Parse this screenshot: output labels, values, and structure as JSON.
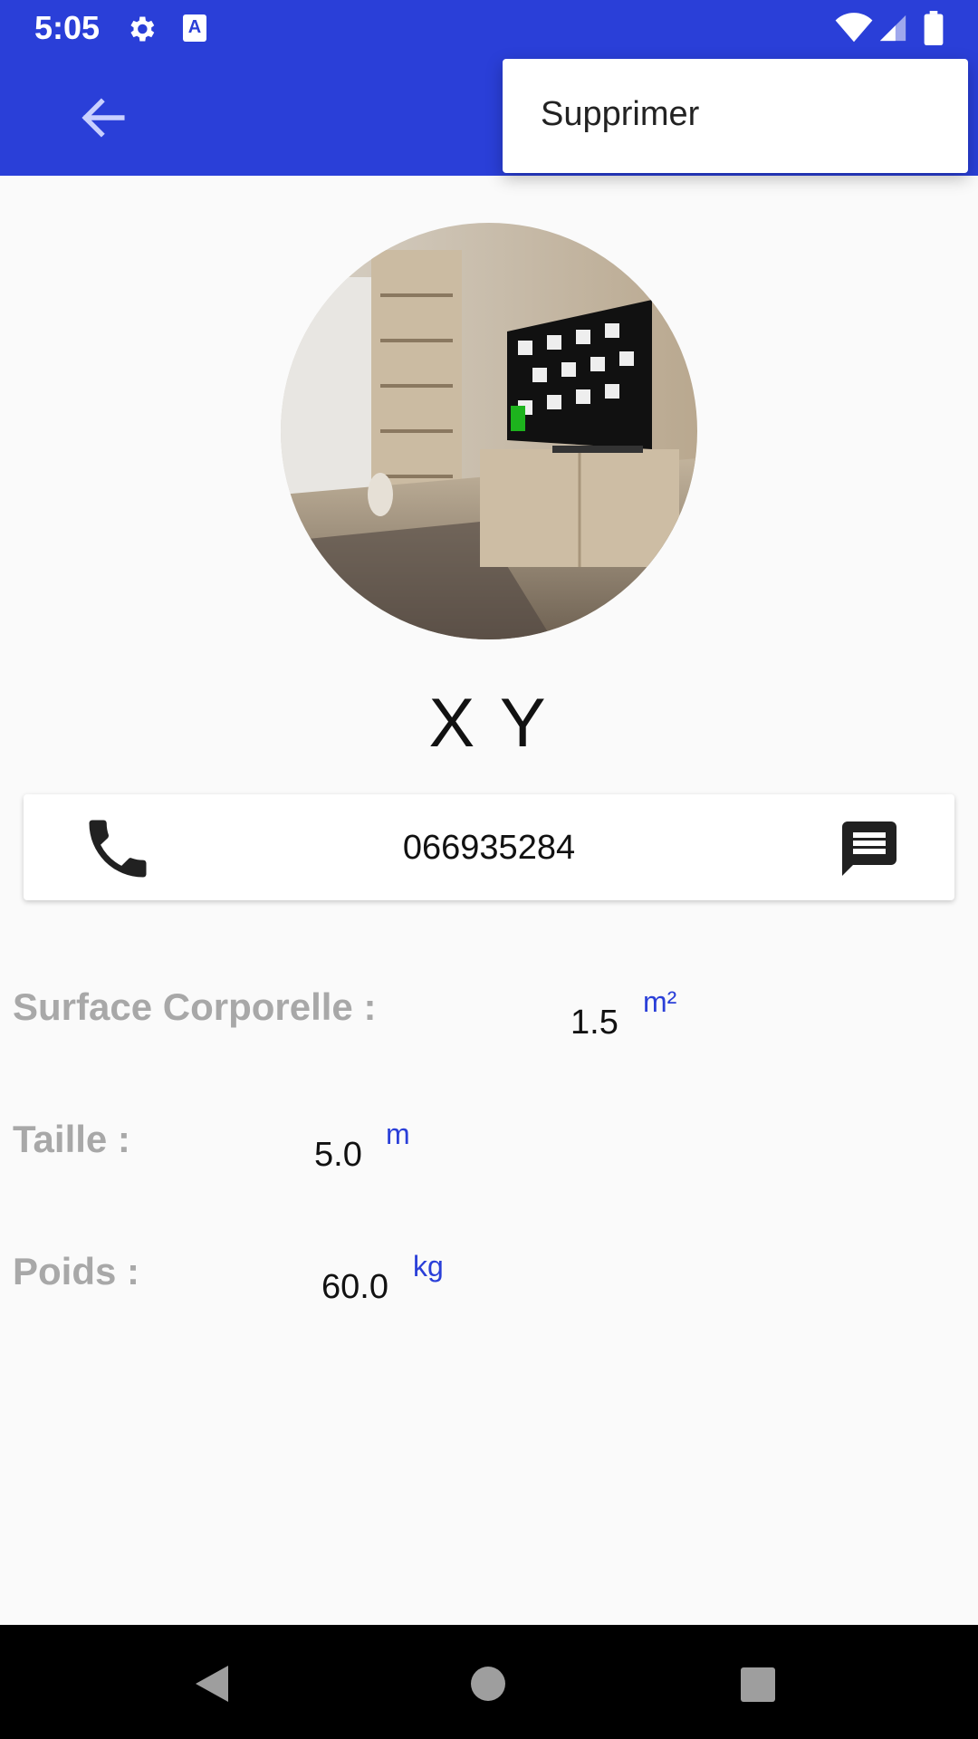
{
  "status_bar": {
    "time": "5:05",
    "a_icon_label": "A"
  },
  "app_bar": {
    "back_icon": "arrow-back-icon"
  },
  "overflow_menu": {
    "items": [
      {
        "label": "Supprimer"
      }
    ]
  },
  "profile": {
    "name": "X Y",
    "avatar_icon": "profile-photo"
  },
  "contact": {
    "phone_number": "066935284",
    "call_icon": "phone-icon",
    "message_icon": "message-icon"
  },
  "details": {
    "rows": [
      {
        "label": "Surface Corporelle :",
        "value": "1.5",
        "unit": "m²"
      },
      {
        "label": "Taille :",
        "value": "5.0",
        "unit": "m"
      },
      {
        "label": "Poids :",
        "value": "60.0",
        "unit": "kg"
      }
    ]
  },
  "colors": {
    "primary": "#2a3fd8",
    "label_gray": "#a8a8a8",
    "background": "#fafafa"
  }
}
